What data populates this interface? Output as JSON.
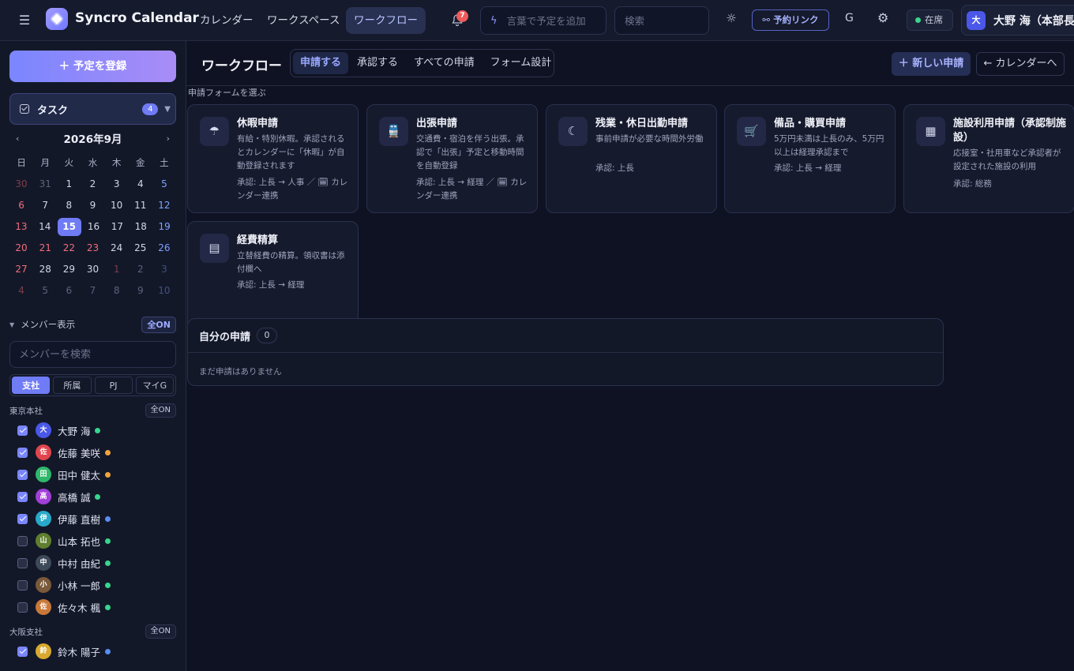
{
  "topbar": {
    "brand": "Syncro Calendar",
    "nav": [
      "カレンダー",
      "ワークスペース",
      "ワークフロー"
    ],
    "notifications_count": "7",
    "quick_add_placeholder": "言葉で予定を追加",
    "search_placeholder": "検索",
    "booking_link_label": "予約リンク",
    "g_label": "G",
    "presence_label": "在席",
    "user_initial": "大",
    "user_name": "大野 海（本部長"
  },
  "sidebar": {
    "new_event_label": "＋ 予定を登録",
    "tasks_label": "タスク",
    "tasks_count": "4",
    "calendar_title": "2026年9月",
    "prev": "‹",
    "next": "›",
    "weekdays": [
      "日",
      "月",
      "火",
      "水",
      "木",
      "金",
      "土"
    ],
    "weeks": [
      [
        "30",
        "31",
        "1",
        "2",
        "3",
        "4",
        "5"
      ],
      [
        "6",
        "7",
        "8",
        "9",
        "10",
        "11",
        "12"
      ],
      [
        "13",
        "14",
        "15",
        "16",
        "17",
        "18",
        "19"
      ],
      [
        "20",
        "21",
        "22",
        "23",
        "24",
        "25",
        "26"
      ],
      [
        "27",
        "28",
        "29",
        "30",
        "1",
        "2",
        "3"
      ],
      [
        "4",
        "5",
        "6",
        "7",
        "8",
        "9",
        "10"
      ]
    ],
    "members_label": "メンバー表示",
    "all_on": "全ON",
    "member_search_placeholder": "メンバーを検索",
    "filters": [
      "支社",
      "所属",
      "PJ",
      "マイG"
    ],
    "groups": [
      {
        "name": "東京本社",
        "all_on": "全ON",
        "members": [
          {
            "initial": "大",
            "name": "大野 海",
            "color": "#4a57e8",
            "status": "#37d68c",
            "checked": true
          },
          {
            "initial": "佐",
            "name": "佐藤 美咲",
            "color": "#e0464c",
            "status": "#f0a43c",
            "checked": true
          },
          {
            "initial": "田",
            "name": "田中 健太",
            "color": "#2fb86a",
            "status": "#f0a43c",
            "checked": true
          },
          {
            "initial": "高",
            "name": "高橋 誠",
            "color": "#a23fd8",
            "status": "#37d68c",
            "checked": true
          },
          {
            "initial": "伊",
            "name": "伊藤 直樹",
            "color": "#29a9c9",
            "status": "#5a8df0",
            "checked": true
          },
          {
            "initial": "山",
            "name": "山本 拓也",
            "color": "#5f7f2e",
            "status": "#37d68c",
            "checked": false
          },
          {
            "initial": "中",
            "name": "中村 由紀",
            "color": "#3d4a5a",
            "status": "#37d68c",
            "checked": false
          },
          {
            "initial": "小",
            "name": "小林 一郎",
            "color": "#7a5a3a",
            "status": "#37d68c",
            "checked": false
          },
          {
            "initial": "佐",
            "name": "佐々木 楓",
            "color": "#c9783a",
            "status": "#37d68c",
            "checked": false
          }
        ]
      },
      {
        "name": "大阪支社",
        "all_on": "全ON",
        "members": [
          {
            "initial": "鈴",
            "name": "鈴木 陽子",
            "color": "#d8a92e",
            "status": "#5a8df0",
            "checked": true
          }
        ]
      }
    ]
  },
  "main": {
    "title": "ワークフロー",
    "tabs": [
      "申請する",
      "承認する",
      "すべての申請",
      "フォーム設計"
    ],
    "new_request_label": "＋ 新しい申請",
    "to_calendar_label": "← カレンダーへ",
    "forms_section_label": "申請フォームを選ぶ",
    "forms": [
      {
        "icon": "umbrella-icon",
        "title": "休暇申請",
        "desc": "有給・特別休暇。承認されるとカレンダーに「休暇」が自動登録されます",
        "approval": "承認: 上長 → 人事 ／ 🗓 カレンダー連携"
      },
      {
        "icon": "train-icon",
        "title": "出張申請",
        "desc": "交通費・宿泊を伴う出張。承認で「出張」予定と移動時間を自動登録",
        "approval": "承認: 上長 → 経理 ／ 🗓 カレンダー連携"
      },
      {
        "icon": "moon-icon",
        "title": "残業・休日出勤申請",
        "desc": "事前申請が必要な時間外労働",
        "approval": "承認: 上長"
      },
      {
        "icon": "cart-icon",
        "title": "備品・購買申請",
        "desc": "5万円未満は上長のみ、5万円以上は経理承認まで",
        "approval": "承認: 上長 → 経理"
      },
      {
        "icon": "building-icon",
        "title": "施設利用申請（承認制施設）",
        "desc": "応接室・社用車など承認者が設定された施設の利用",
        "approval": "承認: 総務"
      },
      {
        "icon": "receipt-icon",
        "title": "経費精算",
        "desc": "立替経費の精算。領収書は添付欄へ",
        "approval": "承認: 上長 → 経理"
      }
    ],
    "my_requests_label": "自分の申請",
    "my_requests_count": "0",
    "my_requests_empty": "まだ申請はありません"
  }
}
